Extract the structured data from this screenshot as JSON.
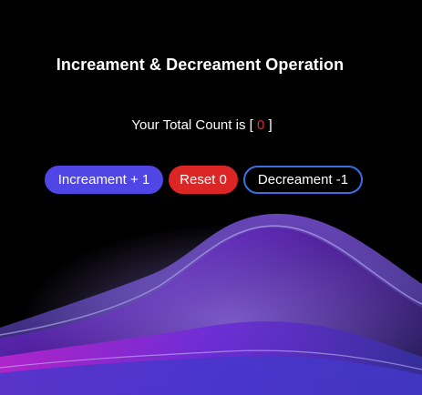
{
  "header": {
    "title": "Increament & Decreament Operation"
  },
  "counter": {
    "label_prefix": "Your Total Count is [ ",
    "value": "0",
    "label_suffix": " ]"
  },
  "buttons": {
    "increment_label": "Increament + 1",
    "reset_label": "Reset 0",
    "decrement_label": "Decreament -1"
  },
  "colors": {
    "background": "#000000",
    "increment_button": "#4f46e5",
    "reset_button": "#dc2626",
    "decrement_border": "#3b6fe0",
    "count_value": "#e02b2b",
    "wave_primary": "#5b3df0",
    "wave_secondary": "#a855f7"
  }
}
